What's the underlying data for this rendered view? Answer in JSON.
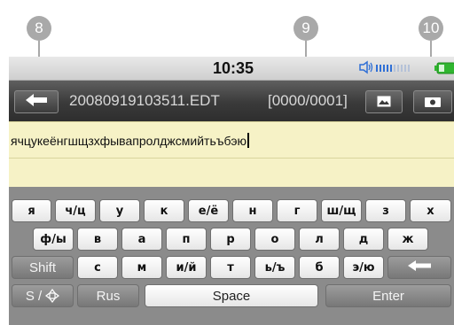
{
  "callouts": [
    "8",
    "9",
    "10"
  ],
  "status_bar": {
    "time": "10:35",
    "volume_icon": "speaker-icon",
    "volume_level": 0.5,
    "battery_icon": "battery-icon"
  },
  "title_bar": {
    "back_icon": "back-arrow-icon",
    "filename": "20080919103511.EDT",
    "counter": "[0000/0001]",
    "picture_icon": "picture-icon",
    "camera_icon": "camera-icon"
  },
  "editor": {
    "text": "ячцукеёнгшщзхфывапролджсмийтьъбэю"
  },
  "keyboard": {
    "row1": [
      "я",
      "ч/ц",
      "у",
      "к",
      "е/ё",
      "н",
      "г",
      "ш/щ",
      "з",
      "х"
    ],
    "row2": [
      "ф/ы",
      "в",
      "а",
      "п",
      "р",
      "о",
      "л",
      "д",
      "ж"
    ],
    "row3_shift": "Shift",
    "row3": [
      "с",
      "м",
      "и/й",
      "т",
      "ь/ъ",
      "б",
      "э/ю"
    ],
    "row3_backspace_icon": "backspace-arrow-icon",
    "row4": {
      "symbols": "S /",
      "symbols_icon": "directional-pad-icon",
      "language": "Rus",
      "space": "Space",
      "enter": "Enter"
    }
  },
  "colors": {
    "marker": "#a9a9a9",
    "title_bar": "#3a3a3a",
    "text_area": "#f6f2c6",
    "keyboard_bg": "#8b8b8b",
    "volume_blue": "#2f6fd6",
    "battery_green": "#2fb52f"
  }
}
